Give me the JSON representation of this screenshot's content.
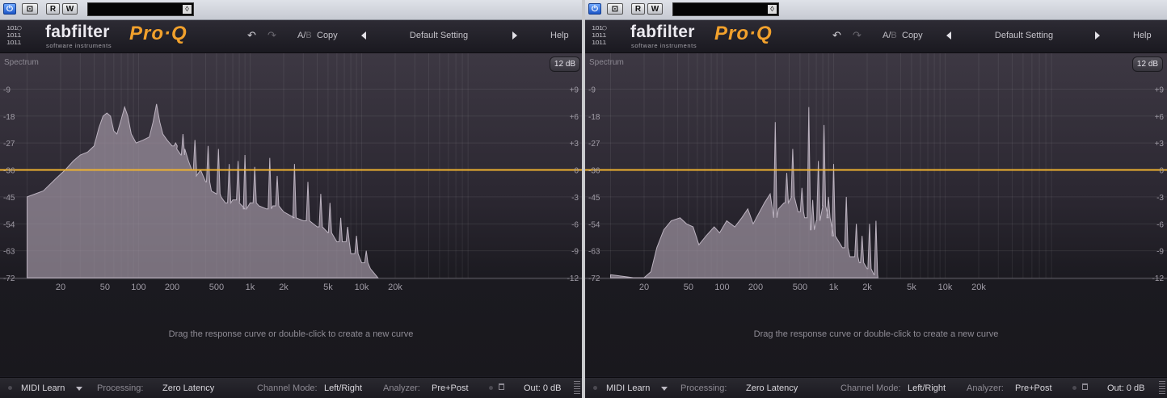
{
  "colors": {
    "accent_line": "#f0b330",
    "spectrum_fill": "#9c929f",
    "spectrum_stroke": "#bcb3c0",
    "brand_orange": "#f2a12c",
    "power_button": "#2f6fe0"
  },
  "panels": [
    {
      "host": {
        "buttons": {
          "power_icon": "power-icon",
          "compare": "⊡",
          "read": "R",
          "write": "W"
        }
      },
      "brand": {
        "logo_dots": "ıoı○\nıoıı\nıoıı",
        "name": "fabfilter",
        "tagline": "software instruments",
        "product": "Pro·Q"
      },
      "header": {
        "undo_icon": "↶",
        "redo_icon": "↷",
        "ab_a": "A/",
        "ab_b": "B",
        "copy": "Copy",
        "preset": "Default Setting",
        "help": "Help"
      },
      "graph": {
        "spectrum_label": "Spectrum",
        "range_button": "12 dB",
        "hint": "Drag the response curve or double-click to create a new curve",
        "freq_labels": [
          "20",
          "50",
          "100",
          "200",
          "500",
          "1k",
          "2k",
          "5k",
          "10k",
          "20k"
        ],
        "freq_values": [
          20,
          50,
          100,
          200,
          500,
          1000,
          2000,
          5000,
          10000,
          20000
        ],
        "left_scale": [
          "-9",
          "-18",
          "-27",
          "-36",
          "-45",
          "-54",
          "-63",
          "-72"
        ],
        "right_scale": [
          "+9",
          "+6",
          "+3",
          "0",
          "-3",
          "-6",
          "-9",
          "-12"
        ],
        "spectrum": [
          [
            10,
            -45
          ],
          [
            14,
            -43
          ],
          [
            18,
            -39
          ],
          [
            22,
            -36
          ],
          [
            26,
            -33
          ],
          [
            30,
            -31
          ],
          [
            35,
            -30
          ],
          [
            40,
            -28
          ],
          [
            44,
            -22
          ],
          [
            48,
            -18
          ],
          [
            52,
            -17
          ],
          [
            56,
            -18
          ],
          [
            60,
            -23
          ],
          [
            64,
            -24
          ],
          [
            70,
            -19
          ],
          [
            75,
            -15
          ],
          [
            80,
            -18
          ],
          [
            86,
            -24
          ],
          [
            95,
            -27
          ],
          [
            110,
            -26
          ],
          [
            125,
            -25
          ],
          [
            135,
            -20
          ],
          [
            145,
            -14
          ],
          [
            155,
            -20
          ],
          [
            165,
            -24
          ],
          [
            180,
            -26
          ],
          [
            200,
            -28
          ],
          [
            220,
            -29
          ],
          [
            240,
            -31
          ],
          [
            260,
            -29
          ],
          [
            280,
            -33
          ],
          [
            300,
            -36
          ],
          [
            330,
            -38
          ],
          [
            360,
            -36
          ],
          [
            400,
            -40
          ],
          [
            450,
            -43
          ],
          [
            500,
            -44
          ],
          [
            550,
            -45
          ],
          [
            600,
            -47
          ],
          [
            700,
            -46
          ],
          [
            800,
            -47
          ],
          [
            900,
            -49
          ],
          [
            1000,
            -47
          ],
          [
            1200,
            -48
          ],
          [
            1400,
            -49
          ],
          [
            1600,
            -48
          ],
          [
            2000,
            -50
          ],
          [
            2500,
            -52
          ],
          [
            3000,
            -53
          ],
          [
            4000,
            -55
          ],
          [
            5000,
            -57
          ],
          [
            6000,
            -60
          ],
          [
            8000,
            -64
          ],
          [
            10000,
            -67
          ],
          [
            12000,
            -69
          ],
          [
            14000,
            -72
          ]
        ],
        "spectrum_peaks": [
          [
            215,
            -27
          ],
          [
            250,
            -24
          ],
          [
            320,
            -26
          ],
          [
            420,
            -28
          ],
          [
            520,
            -29
          ],
          [
            650,
            -34
          ],
          [
            780,
            -33
          ],
          [
            900,
            -31
          ],
          [
            1100,
            -35
          ],
          [
            1500,
            -32
          ],
          [
            1750,
            -38
          ],
          [
            2500,
            -34
          ],
          [
            3300,
            -40
          ],
          [
            4300,
            -44
          ],
          [
            5200,
            -47
          ],
          [
            6500,
            -52
          ],
          [
            7500,
            -55
          ],
          [
            9000,
            -58
          ],
          [
            11000,
            -63
          ]
        ]
      },
      "bottom": {
        "midi": "MIDI Learn",
        "processing_label": "Processing:",
        "processing_value": "Zero Latency",
        "channel_label": "Channel Mode:",
        "channel_value": "Left/Right",
        "analyzer_label": "Analyzer:",
        "analyzer_value": "Pre+Post",
        "output": "Out: 0 dB"
      }
    },
    {
      "host": {
        "buttons": {
          "power_icon": "power-icon",
          "compare": "⊡",
          "read": "R",
          "write": "W"
        }
      },
      "brand": {
        "logo_dots": "ıoı○\nıoıı\nıoıı",
        "name": "fabfilter",
        "tagline": "software instruments",
        "product": "Pro·Q"
      },
      "header": {
        "undo_icon": "↶",
        "redo_icon": "↷",
        "ab_a": "A/",
        "ab_b": "B",
        "copy": "Copy",
        "preset": "Default Setting",
        "help": "Help"
      },
      "graph": {
        "spectrum_label": "Spectrum",
        "range_button": "12 dB",
        "hint": "Drag the response curve or double-click to create a new curve",
        "freq_labels": [
          "20",
          "50",
          "100",
          "200",
          "500",
          "1k",
          "2k",
          "5k",
          "10k",
          "20k"
        ],
        "freq_values": [
          20,
          50,
          100,
          200,
          500,
          1000,
          2000,
          5000,
          10000,
          20000
        ],
        "left_scale": [
          "-9",
          "-18",
          "-27",
          "-36",
          "-45",
          "-54",
          "-63",
          "-72"
        ],
        "right_scale": [
          "+9",
          "+6",
          "+3",
          "0",
          "-3",
          "-6",
          "-9",
          "-12"
        ],
        "spectrum": [
          [
            10,
            -71
          ],
          [
            16,
            -72
          ],
          [
            20,
            -72
          ],
          [
            23,
            -70
          ],
          [
            26,
            -62
          ],
          [
            30,
            -56
          ],
          [
            35,
            -53
          ],
          [
            42,
            -52
          ],
          [
            48,
            -54
          ],
          [
            55,
            -55
          ],
          [
            62,
            -61
          ],
          [
            72,
            -58
          ],
          [
            85,
            -55
          ],
          [
            95,
            -57
          ],
          [
            110,
            -53
          ],
          [
            130,
            -55
          ],
          [
            150,
            -52
          ],
          [
            170,
            -49
          ],
          [
            190,
            -54
          ],
          [
            210,
            -51
          ],
          [
            240,
            -47
          ],
          [
            270,
            -44
          ],
          [
            290,
            -52
          ],
          [
            320,
            -49
          ],
          [
            360,
            -47
          ],
          [
            420,
            -45
          ],
          [
            480,
            -50
          ],
          [
            550,
            -52
          ],
          [
            620,
            -56
          ],
          [
            700,
            -53
          ],
          [
            800,
            -48
          ],
          [
            900,
            -52
          ],
          [
            1000,
            -58
          ],
          [
            1200,
            -62
          ],
          [
            1400,
            -65
          ],
          [
            1700,
            -67
          ],
          [
            2000,
            -69
          ],
          [
            2300,
            -71
          ],
          [
            2500,
            -72
          ]
        ],
        "spectrum_peaks": [
          [
            300,
            -20
          ],
          [
            380,
            -37
          ],
          [
            430,
            -29
          ],
          [
            520,
            -42
          ],
          [
            600,
            -15
          ],
          [
            650,
            -46
          ],
          [
            730,
            -33
          ],
          [
            820,
            -21
          ],
          [
            900,
            -45
          ],
          [
            1000,
            -34
          ],
          [
            1300,
            -45
          ],
          [
            1600,
            -54
          ],
          [
            1800,
            -58
          ],
          [
            2100,
            -54
          ],
          [
            2400,
            -53
          ]
        ]
      },
      "bottom": {
        "midi": "MIDI Learn",
        "processing_label": "Processing:",
        "processing_value": "Zero Latency",
        "channel_label": "Channel Mode:",
        "channel_value": "Left/Right",
        "analyzer_label": "Analyzer:",
        "analyzer_value": "Pre+Post",
        "output": "Out: 0 dB"
      }
    }
  ]
}
